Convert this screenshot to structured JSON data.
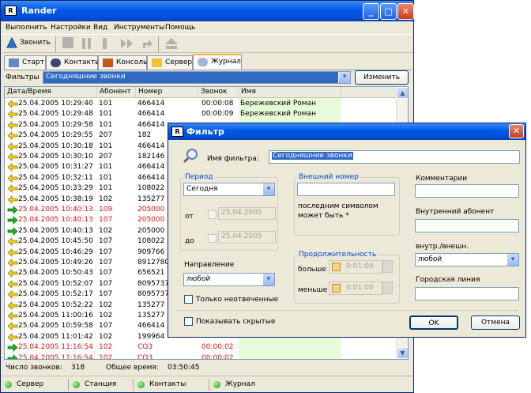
{
  "window": {
    "title": "Rander"
  },
  "menu": [
    "Выполнить",
    "Настройки",
    "Вид",
    "Инструменты",
    "Помощь"
  ],
  "toolbar": {
    "call_label": "Звонить"
  },
  "tabs": [
    "Старт",
    "Контакты",
    "Консоль",
    "Сервер",
    "Журнал"
  ],
  "filter_bar": {
    "label": "Фильтры",
    "selected": "Сегодняшние звонки",
    "edit_button": "Изменить"
  },
  "grid": {
    "columns": [
      "Дата/Время",
      "Абонент",
      "Номер",
      "Звонок",
      "Имя"
    ],
    "rows": [
      {
        "dt": "25.04.2005 10:29:40",
        "ab": "101",
        "num": "466414",
        "dur": "00:00:08",
        "name": "Бережевский Роман",
        "dir": "in",
        "red": false
      },
      {
        "dt": "25.04.2005 10:29:48",
        "ab": "101",
        "num": "466414",
        "dur": "00:00:09",
        "name": "Бережевский Роман",
        "dir": "in",
        "red": false
      },
      {
        "dt": "25.04.2005 10:29:58",
        "ab": "101",
        "num": "466414",
        "dur": "",
        "name": "",
        "dir": "in",
        "red": false
      },
      {
        "dt": "25.04.2005 10:29:55",
        "ab": "207",
        "num": "182",
        "dur": "",
        "name": "",
        "dir": "in",
        "red": false
      },
      {
        "dt": "25.04.2005 10:30:18",
        "ab": "101",
        "num": "466414",
        "dur": "",
        "name": "",
        "dir": "in",
        "red": false
      },
      {
        "dt": "25.04.2005 10:30:10",
        "ab": "207",
        "num": "182146",
        "dur": "",
        "name": "",
        "dir": "in",
        "red": false
      },
      {
        "dt": "25.04.2005 10:31:27",
        "ab": "101",
        "num": "466414",
        "dur": "",
        "name": "",
        "dir": "in",
        "red": false
      },
      {
        "dt": "25.04.2005 10:32:11",
        "ab": "101",
        "num": "466414",
        "dur": "",
        "name": "",
        "dir": "in",
        "red": false
      },
      {
        "dt": "25.04.2005 10:33:29",
        "ab": "101",
        "num": "108022",
        "dur": "",
        "name": "",
        "dir": "in",
        "red": false
      },
      {
        "dt": "25.04.2005 10:38:19",
        "ab": "102",
        "num": "135277",
        "dur": "",
        "name": "",
        "dir": "in",
        "red": false
      },
      {
        "dt": "25.04.2005 10:40:13",
        "ab": "109",
        "num": "205000",
        "dur": "",
        "name": "",
        "dir": "out",
        "red": true
      },
      {
        "dt": "25.04.2005 10:40:13",
        "ab": "107",
        "num": "205000",
        "dur": "",
        "name": "",
        "dir": "out",
        "red": true
      },
      {
        "dt": "25.04.2005 10:40:13",
        "ab": "102",
        "num": "205000",
        "dur": "",
        "name": "",
        "dir": "out",
        "red": false
      },
      {
        "dt": "25.04.2005 10:45:50",
        "ab": "107",
        "num": "108022",
        "dur": "",
        "name": "",
        "dir": "in",
        "red": false
      },
      {
        "dt": "25.04.2005 10:46:29",
        "ab": "107",
        "num": "909766",
        "dur": "",
        "name": "",
        "dir": "in",
        "red": false
      },
      {
        "dt": "25.04.2005 10:49:26",
        "ab": "107",
        "num": "89127801",
        "dur": "",
        "name": "",
        "dir": "in",
        "red": false
      },
      {
        "dt": "25.04.2005 10:50:43",
        "ab": "107",
        "num": "656521",
        "dur": "",
        "name": "",
        "dir": "in",
        "red": false
      },
      {
        "dt": "25.04.2005 10:52:07",
        "ab": "107",
        "num": "80957374",
        "dur": "",
        "name": "",
        "dir": "in",
        "red": false
      },
      {
        "dt": "25.04.2005 10:52:17",
        "ab": "107",
        "num": "80957374",
        "dur": "",
        "name": "",
        "dir": "in",
        "red": false
      },
      {
        "dt": "25.04.2005 10:52:22",
        "ab": "102",
        "num": "135277",
        "dur": "",
        "name": "",
        "dir": "in",
        "red": false
      },
      {
        "dt": "25.04.2005 11:00:16",
        "ab": "102",
        "num": "135277",
        "dur": "",
        "name": "",
        "dir": "in",
        "red": false
      },
      {
        "dt": "25.04.2005 10:59:58",
        "ab": "107",
        "num": "466414",
        "dur": "",
        "name": "",
        "dir": "in",
        "red": false
      },
      {
        "dt": "25.04.2005 11:01:42",
        "ab": "102",
        "num": "199964",
        "dur": "",
        "name": "",
        "dir": "in",
        "red": false
      },
      {
        "dt": "25.04.2005 11:16:54",
        "ab": "102",
        "num": "CO3",
        "dur": "00:00:02",
        "name": "",
        "dir": "out",
        "red": true
      },
      {
        "dt": "25.04.2005 11:16:54",
        "ab": "102",
        "num": "CO3",
        "dur": "00:00:02",
        "name": "",
        "dir": "out",
        "red": true
      }
    ]
  },
  "summary": {
    "calls_label": "Число звонков:",
    "calls_value": "318",
    "time_label": "Общее время:",
    "time_value": "03:50:45"
  },
  "statusbar": [
    "Сервер",
    "Станция",
    "Контакты",
    "Журнал"
  ],
  "dialog": {
    "title": "Фильтр",
    "filter_name_label": "Имя фильтра:",
    "filter_name_value": "Сегодняшние звонки",
    "period_label": "Период",
    "period_value": "Сегодня",
    "from_label": "от",
    "to_label": "до",
    "from_date": "25.04.2005",
    "to_date": "25.04.2005",
    "direction_label": "Направление",
    "direction_value": "любой",
    "unanswered_label": "Только неотвеченные",
    "external_label": "Внешний номер",
    "external_hint": "последним символом может быть *",
    "duration_label": "Продолжительность",
    "more_label": "больше",
    "less_label": "меньше",
    "more_value": "0:01:00",
    "less_value": "0:01:00",
    "comments_label": "Комментарии",
    "internal_label": "Внутренний абонент",
    "int_ext_label": "внутр./внешн.",
    "int_ext_value": "любой",
    "city_label": "Городская линия",
    "show_hidden_label": "Показывать скрытые",
    "ok_label": "OK",
    "cancel_label": "Отмена"
  }
}
